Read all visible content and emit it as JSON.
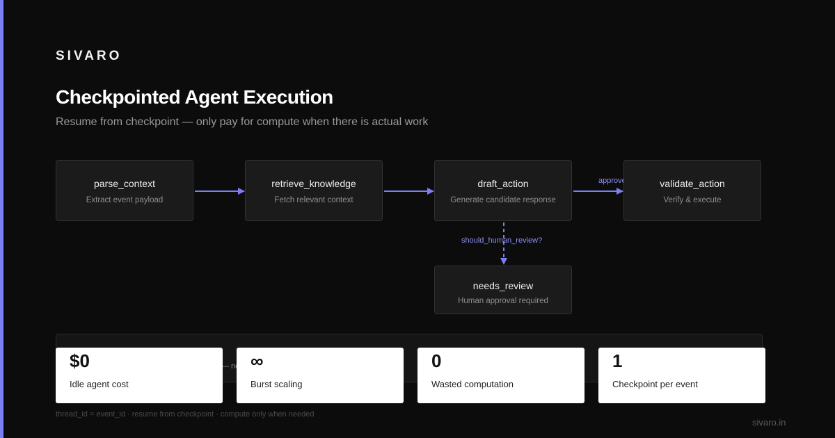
{
  "brand": "SIVARO",
  "title": "Checkpointed Agent Execution",
  "subtitle": "Resume from checkpoint — only pay for compute when there is actual work",
  "nodes": [
    {
      "name": "parse_context",
      "desc": "Extract event payload"
    },
    {
      "name": "retrieve_knowledge",
      "desc": "Fetch relevant context"
    },
    {
      "name": "draft_action",
      "desc": "Generate candidate response"
    },
    {
      "name": "validate_action",
      "desc": "Verify & execute"
    },
    {
      "name": "needs_review",
      "desc": "Human approval required"
    }
  ],
  "edges": {
    "approved_label": "approved",
    "review_label": "should_human_review?"
  },
  "panel_fragment": "— ne",
  "stats": [
    {
      "value": "$0",
      "label": "Idle agent cost"
    },
    {
      "value": "∞",
      "label": "Burst scaling"
    },
    {
      "value": "0",
      "label": "Wasted computation"
    },
    {
      "value": "1",
      "label": "Checkpoint per event"
    }
  ],
  "footer_note": "thread_id = event_id · resume from checkpoint · compute only when needed",
  "footer_url": "sivaro.in",
  "colors": {
    "accent": "#7b7ff5",
    "background": "#0c0c0c",
    "node_bg": "#1b1b1c"
  }
}
